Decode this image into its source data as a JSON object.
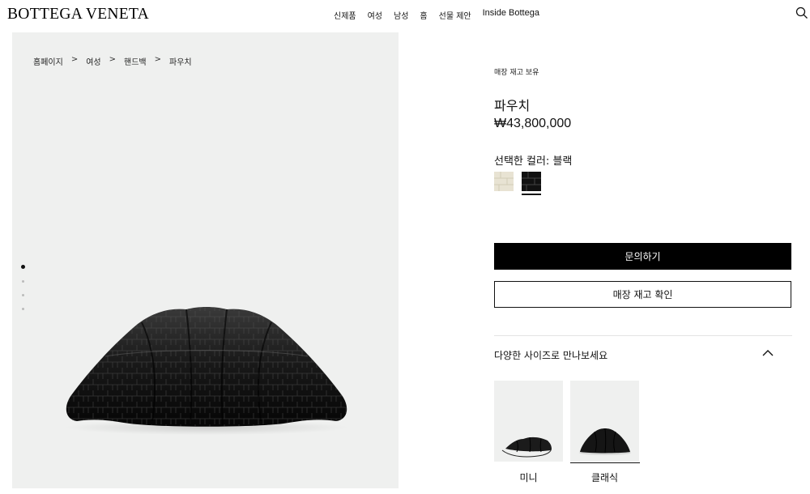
{
  "header": {
    "logo": "BOTTEGA VENETA",
    "nav": [
      "신제품",
      "여성",
      "남성",
      "홈",
      "선물 제안",
      "Inside Bottega"
    ],
    "search_icon": "search-icon"
  },
  "breadcrumb": [
    "홈페이지",
    "여성",
    "핸드백",
    "파우치"
  ],
  "breadcrumb_separator": ">",
  "gallery": {
    "image_count": 4,
    "active_index": 0
  },
  "product": {
    "stock_status": "매장 재고 보유",
    "name": "파우치",
    "price": "₩43,800,000",
    "color_label": "선택한 컬러: 블랙",
    "swatches": [
      {
        "name": "ivory",
        "color": "#e8e3d3"
      },
      {
        "name": "black",
        "color": "#111111",
        "selected": true
      }
    ],
    "primary_button": "문의하기",
    "secondary_button": "매장 재고 확인"
  },
  "sizes": {
    "heading": "다양한 사이즈로 만나보세요",
    "items": [
      {
        "label": "미니"
      },
      {
        "label": "클래식",
        "selected": true
      }
    ]
  },
  "colors": {
    "gallery_bg": "#eff0ef",
    "primary_button_bg": "#000000",
    "accent": "#111111"
  }
}
